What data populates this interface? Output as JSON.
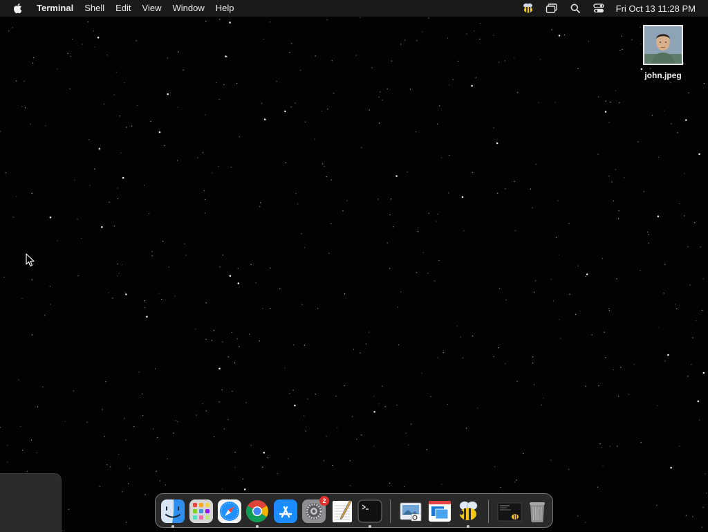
{
  "menubar": {
    "apple_icon": "apple-icon",
    "app_name": "Terminal",
    "menus": [
      "Shell",
      "Edit",
      "View",
      "Window",
      "Help"
    ],
    "status_icons": [
      "bee-app-icon",
      "screen-mirroring-icon",
      "search-icon",
      "control-center-icon"
    ],
    "clock": "Fri Oct 13  11:28 PM"
  },
  "desktop": {
    "wallpaper": "starfield",
    "files": [
      {
        "label": "john.jpeg",
        "icon": "image-thumbnail"
      }
    ]
  },
  "dock": {
    "apps": [
      {
        "name": "Finder",
        "icon": "finder-icon",
        "running": true
      },
      {
        "name": "Launchpad",
        "icon": "launchpad-icon",
        "running": false
      },
      {
        "name": "Safari",
        "icon": "safari-icon",
        "running": false
      },
      {
        "name": "Google Chrome",
        "icon": "chrome-icon",
        "running": true
      },
      {
        "name": "App Store",
        "icon": "app-store-icon",
        "running": false
      },
      {
        "name": "System Settings",
        "icon": "settings-icon",
        "running": false,
        "badge": "2"
      },
      {
        "name": "TextEdit",
        "icon": "textedit-icon",
        "running": false
      },
      {
        "name": "Terminal",
        "icon": "terminal-icon",
        "running": true
      },
      {
        "name": "Preview",
        "icon": "preview-icon",
        "running": false
      },
      {
        "name": "Window Manager",
        "icon": "window-manager-icon",
        "running": false
      },
      {
        "name": "Bee App",
        "icon": "bee-icon",
        "running": true
      }
    ],
    "recent": [
      {
        "name": "Terminal window",
        "icon": "window-thumbnail-icon"
      }
    ],
    "trash": {
      "name": "Trash",
      "icon": "trash-icon"
    }
  },
  "colors": {
    "menubar_bg": "#1a1a1a",
    "badge_red": "#e5322d",
    "chrome_red": "#db4437",
    "chrome_yellow": "#f4b400",
    "chrome_green": "#0f9d58",
    "chrome_blue": "#4285f4"
  }
}
